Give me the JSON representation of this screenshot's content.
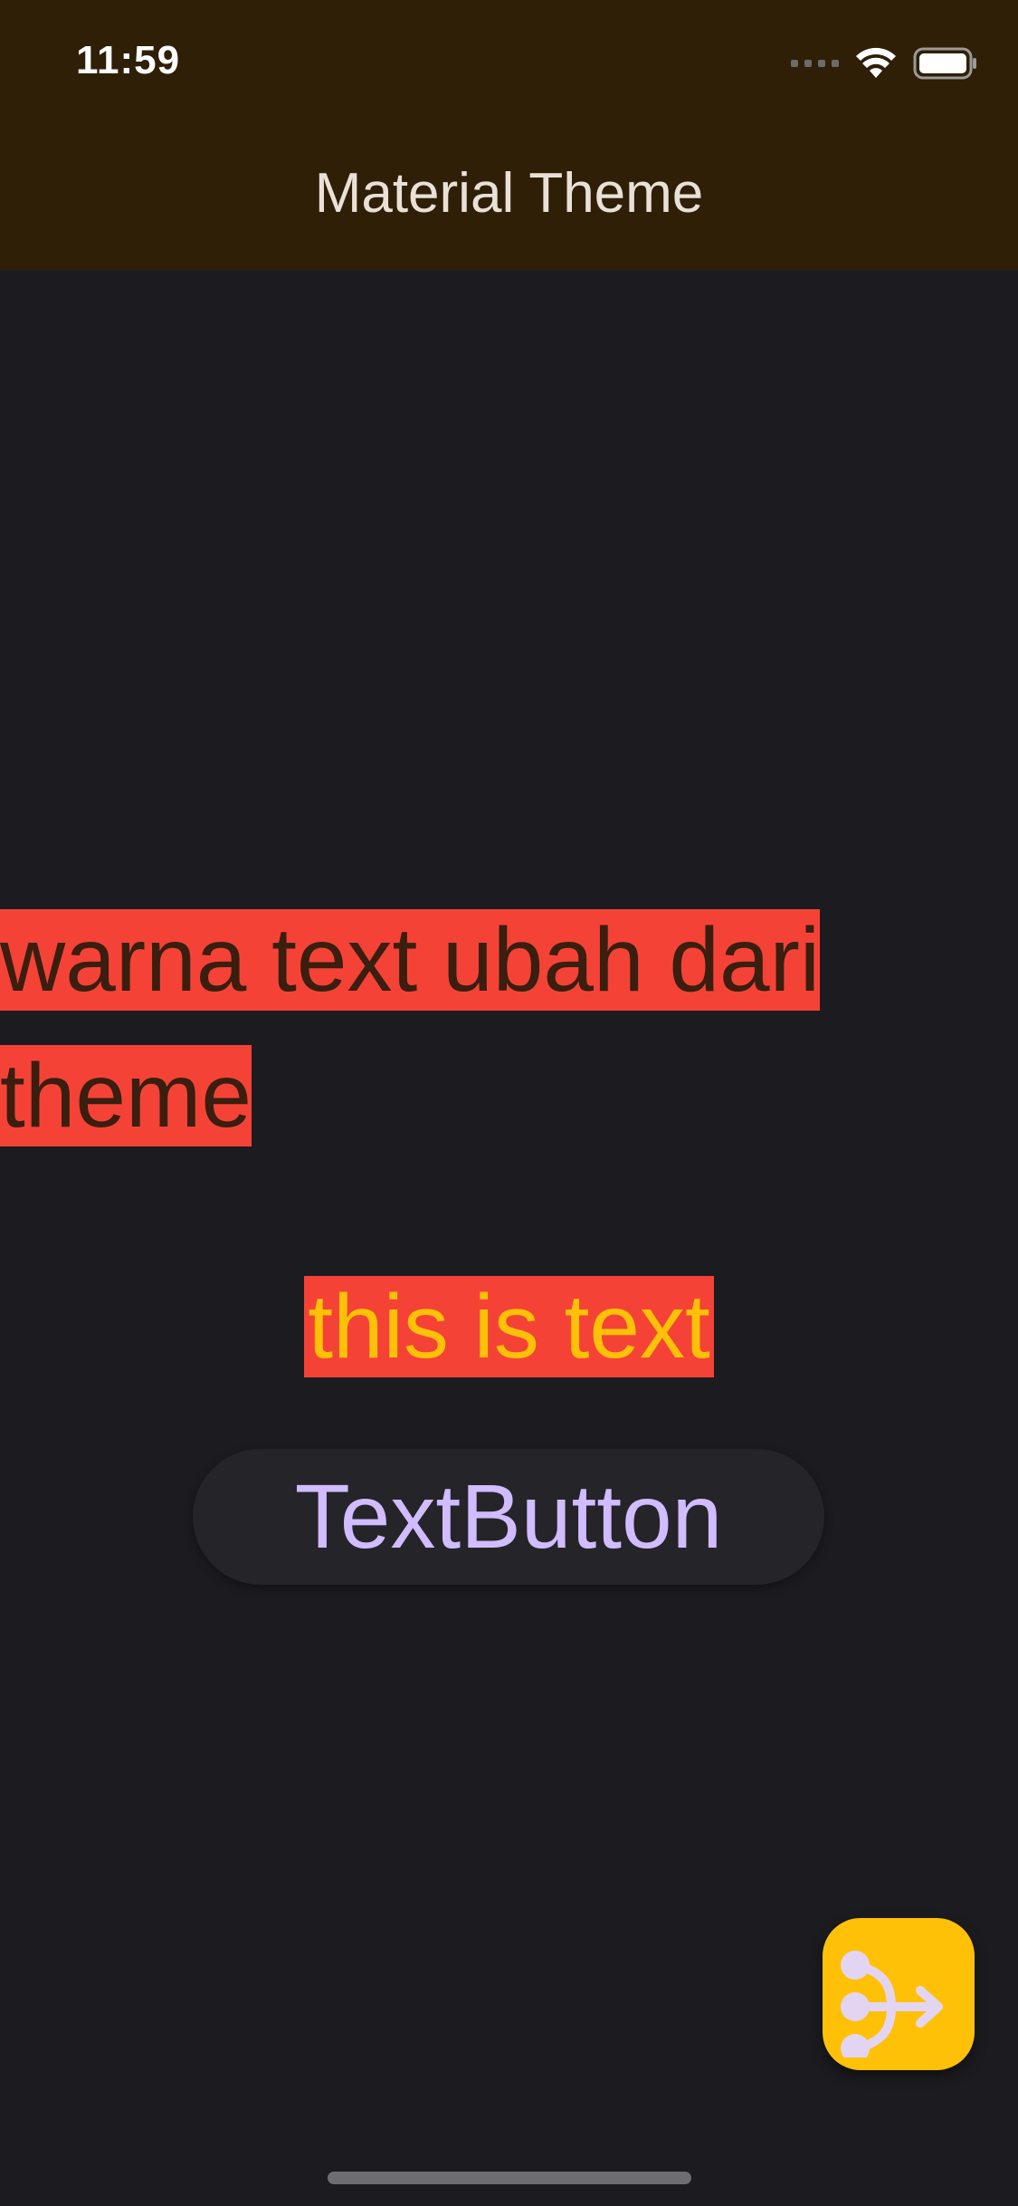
{
  "status_bar": {
    "time": "11:59",
    "icons": [
      "cellular-signal-icon",
      "wifi-icon",
      "battery-icon"
    ]
  },
  "app_bar": {
    "title": "Material Theme"
  },
  "body": {
    "text_primary": "warna text ubah dari theme",
    "text_secondary": "this is text",
    "text_button_label": "TextButton"
  },
  "fab": {
    "icon": "call-split-icon"
  },
  "colors": {
    "app_bar_bg": "#2f1f07",
    "background": "#1c1b1f",
    "highlight_bg": "#f44336",
    "primary_text": "#3a1e0f",
    "secondary_text": "#ffc107",
    "button_text": "#d0bcff",
    "fab_bg": "#ffc107"
  }
}
